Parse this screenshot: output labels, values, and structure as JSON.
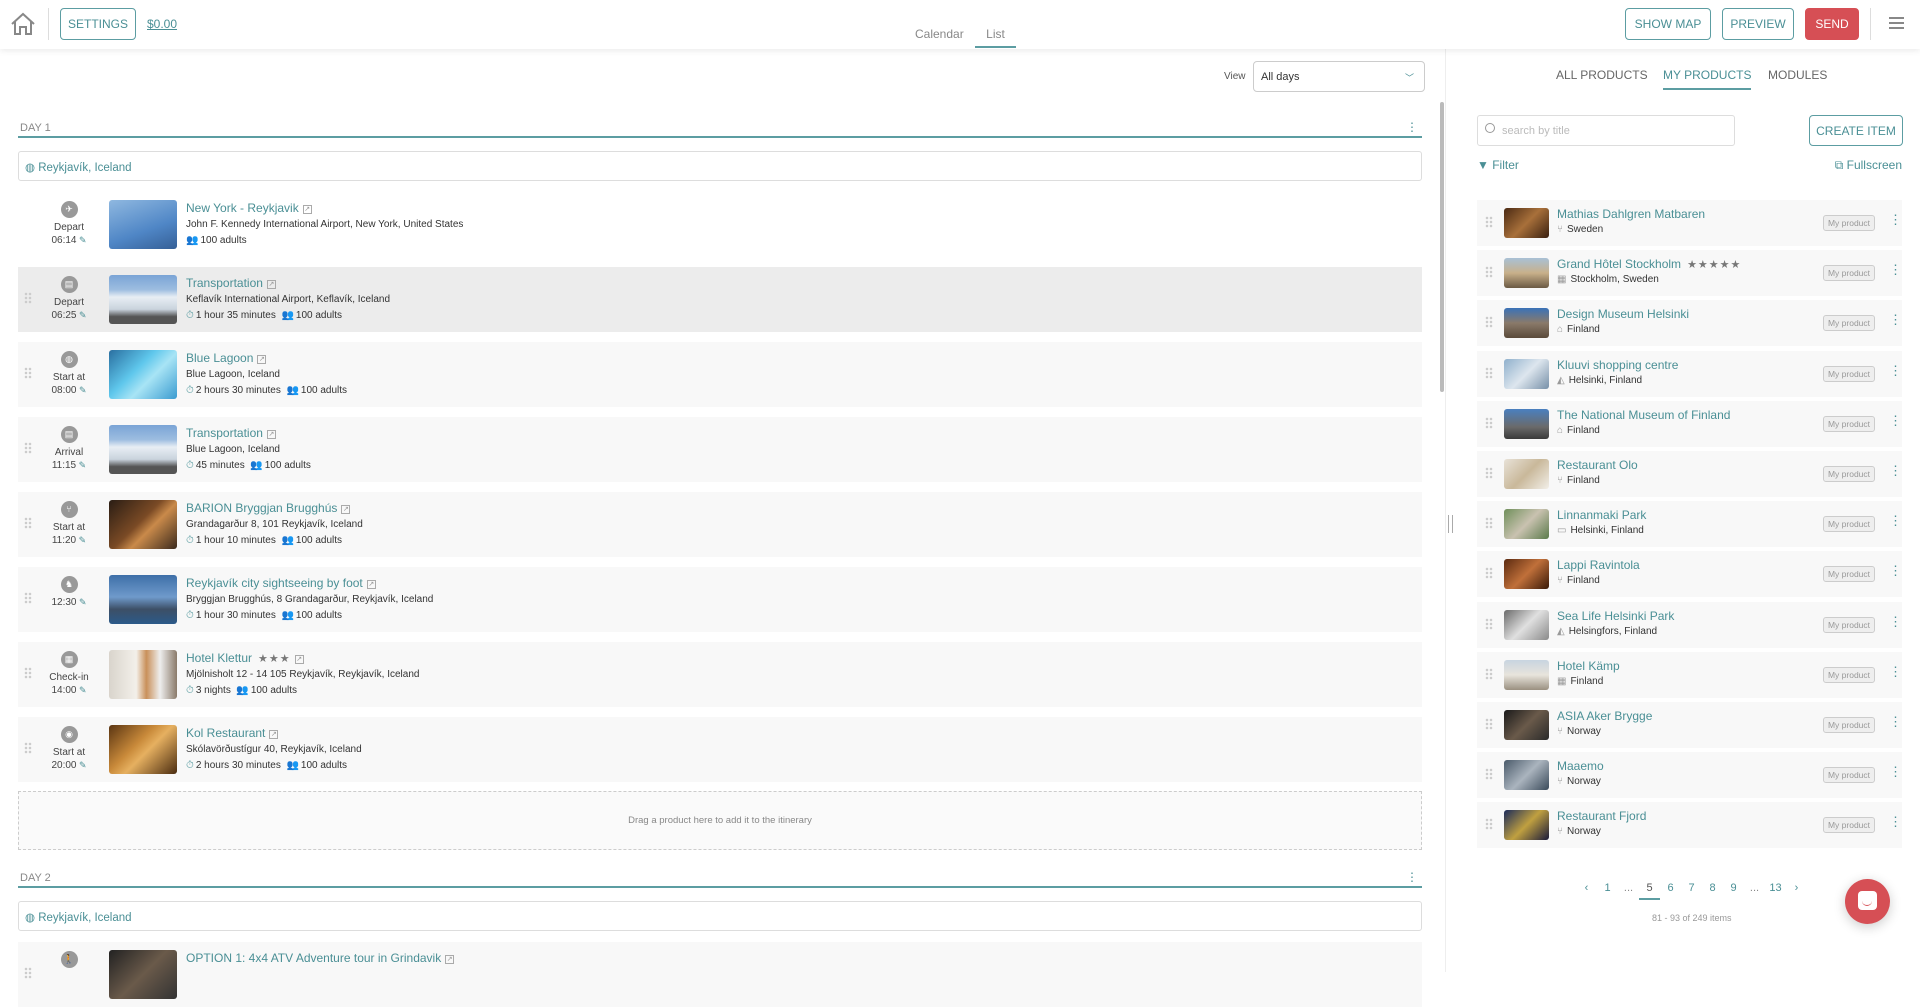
{
  "header": {
    "settings": "SETTINGS",
    "price": "$0.00",
    "view_tabs": [
      "Calendar",
      "List"
    ],
    "show_map": "SHOW MAP",
    "preview": "PREVIEW",
    "send": "SEND"
  },
  "view": {
    "label": "View",
    "selected": "All days"
  },
  "days": [
    {
      "label": "DAY 1",
      "location": "Reykjavík, Iceland",
      "rows": [
        {
          "icon": "plane-icon",
          "glyph": "✈",
          "status": "Depart",
          "time": "06:14",
          "title": "New York - Reykjavik",
          "address": "John F. Kennedy International Airport, New York, United States",
          "duration": "",
          "guests": "100 adults",
          "stars": "",
          "img": "linear-gradient(160deg,#8fb8e0,#4f86c6 60%,#355f96)"
        },
        {
          "icon": "bus-icon",
          "glyph": "▤",
          "status": "Depart",
          "time": "06:25",
          "title": "Transportation",
          "address": "Keflavík International Airport, Keflavík, Iceland",
          "duration": "1 hour 35 minutes",
          "guests": "100 adults",
          "stars": "",
          "img": "linear-gradient(180deg,#7aa4d6 0,#9dbde0 30%,#e8eef4 45%,#c9d3dd 70%,#555 85%)"
        },
        {
          "icon": "globe-icon",
          "glyph": "◍",
          "status": "Start at",
          "time": "08:00",
          "title": "Blue Lagoon",
          "address": "Blue Lagoon, Iceland",
          "duration": "2 hours 30 minutes",
          "guests": "100 adults",
          "stars": "",
          "img": "linear-gradient(135deg,#2a6fa0,#5fc7ec 40%,#a8e4f5 60%,#3a9bd0)"
        },
        {
          "icon": "bus-icon",
          "glyph": "▤",
          "status": "Arrival",
          "time": "11:15",
          "title": "Transportation",
          "address": "Blue Lagoon, Iceland",
          "duration": "45 minutes",
          "guests": "100 adults",
          "stars": "",
          "img": "linear-gradient(180deg,#7aa4d6 0,#9dbde0 30%,#e8eef4 45%,#c9d3dd 70%,#555 85%)"
        },
        {
          "icon": "restaurant-icon",
          "glyph": "⑂",
          "status": "Start at",
          "time": "11:20",
          "title": "BARION Bryggjan Brugghús",
          "address": "Grandagarður 8, 101 Reykjavík, Iceland",
          "duration": "1 hour 10 minutes",
          "guests": "100 adults",
          "stars": "",
          "img": "linear-gradient(135deg,#2a1d14,#7a4a25 45%,#c98a4a 60%,#3b2a1d)"
        },
        {
          "icon": "hiking-icon",
          "glyph": "♞",
          "status": "",
          "time": "12:30",
          "title": "Reykjavík city sightseeing by foot",
          "address": "Bryggjan Brugghús, 8 Grandagarður, Reykjavík, Iceland",
          "duration": "1 hour 30 minutes",
          "guests": "100 adults",
          "stars": "",
          "img": "linear-gradient(180deg,#3e6fa8,#6f9acb 45%,#3d4f66 70%,#2b5a8a)"
        },
        {
          "icon": "hotel-icon",
          "glyph": "▦",
          "status": "Check-in",
          "time": "14:00",
          "title": "Hotel Klettur",
          "address": "Mjölnisholt 12 - 14 105 Reykjavík, Reykjavík, Iceland",
          "duration": "3 nights",
          "guests": "100 adults",
          "stars": "★★★",
          "img": "linear-gradient(90deg,#d9d4cc,#f3f0ea 40%,#c9905a 55%,#eee 75%,#8a7a6a)"
        },
        {
          "icon": "camera-icon",
          "glyph": "◉",
          "status": "Start at",
          "time": "20:00",
          "title": "Kol Restaurant",
          "address": "Skólavörðustígur 40, Reykjavík, Iceland",
          "duration": "2 hours 30 minutes",
          "guests": "100 adults",
          "stars": "",
          "img": "linear-gradient(135deg,#5a3512,#c98a3a 40%,#e6b060 55%,#4a2c10)"
        }
      ],
      "drop_hint": "Drag a product here to add it to the itinerary"
    },
    {
      "label": "DAY 2",
      "location": "Reykjavík, Iceland",
      "rows": [
        {
          "icon": "walking-icon",
          "glyph": "🚶",
          "status": "",
          "time": "",
          "title": "OPTION 1: 4x4 ATV Adventure tour in Grindavik",
          "address": "",
          "duration": "",
          "guests": "",
          "stars": "",
          "img": "linear-gradient(135deg,#222,#6a5a4a 50%,#333)"
        }
      ]
    }
  ],
  "products": {
    "tabs": [
      "ALL PRODUCTS",
      "MY PRODUCTS",
      "MODULES"
    ],
    "active_tab": 1,
    "search_placeholder": "search by title",
    "create": "CREATE ITEM",
    "filter": "Filter",
    "fullscreen": "Fullscreen",
    "badge": "My product",
    "items": [
      {
        "title": "Mathias Dahlgren Matbaren",
        "place": "Sweden",
        "icon": "restaurant-icon",
        "glyph": "⑂",
        "stars": "",
        "img": "linear-gradient(135deg,#4a2a14,#a8703a 50%,#3a2010)"
      },
      {
        "title": "Grand Hôtel Stockholm",
        "place": "Stockholm, Sweden",
        "icon": "hotel-icon",
        "glyph": "▦",
        "stars": "★★★★★",
        "img": "linear-gradient(180deg,#a9c1d6,#c8b08a 50%,#6b5a44)"
      },
      {
        "title": "Design Museum Helsinki",
        "place": "Finland",
        "icon": "museum-icon",
        "glyph": "⌂",
        "stars": "",
        "img": "linear-gradient(180deg,#3a72b8,#8a7a6a 50%,#5a4a3a)"
      },
      {
        "title": "Kluuvi shopping centre",
        "place": "Helsinki, Finland",
        "icon": "shopping-icon",
        "glyph": "◭",
        "stars": "",
        "img": "linear-gradient(135deg,#8fb0cc,#dde6ee 50%,#7790a8)"
      },
      {
        "title": "The National Museum of Finland",
        "place": "Finland",
        "icon": "museum-icon",
        "glyph": "⌂",
        "stars": "",
        "img": "linear-gradient(180deg,#4a80c0,#6a6a6a 60%,#3a3a3a)"
      },
      {
        "title": "Restaurant Olo",
        "place": "Finland",
        "icon": "restaurant-icon",
        "glyph": "⑂",
        "stars": "",
        "img": "linear-gradient(135deg,#e8e2d8,#c9b89a 50%,#f2efe8)"
      },
      {
        "title": "Linnanmaki Park",
        "place": "Helsinki, Finland",
        "icon": "park-icon",
        "glyph": "▭",
        "stars": "",
        "img": "linear-gradient(135deg,#6f8f5a,#c9c2b0 50%,#5a7a4a)"
      },
      {
        "title": "Lappi Ravintola",
        "place": "Finland",
        "icon": "restaurant-icon",
        "glyph": "⑂",
        "stars": "",
        "img": "linear-gradient(135deg,#5a2a10,#c0703a 50%,#3a1a08)"
      },
      {
        "title": "Sea Life Helsinki Park",
        "place": "Helsingfors, Finland",
        "icon": "attraction-icon",
        "glyph": "◭",
        "stars": "",
        "img": "linear-gradient(135deg,#6a6a6a,#e0e0e0 50%,#8a8a8a)"
      },
      {
        "title": "Hotel Kämp",
        "place": "Finland",
        "icon": "hotel-icon",
        "glyph": "▦",
        "stars": "",
        "img": "linear-gradient(180deg,#c8d4e0,#e8e4dc 50%,#9a9080)"
      },
      {
        "title": "ASIA Aker Brygge",
        "place": "Norway",
        "icon": "restaurant-icon",
        "glyph": "⑂",
        "stars": "",
        "img": "linear-gradient(135deg,#1a1a1a,#6a5a4a 50%,#2a2a2a)"
      },
      {
        "title": "Maaemo",
        "place": "Norway",
        "icon": "restaurant-icon",
        "glyph": "⑂",
        "stars": "",
        "img": "linear-gradient(135deg,#4a5a6a,#aab4be 50%,#3a4a5a)"
      },
      {
        "title": "Restaurant Fjord",
        "place": "Norway",
        "icon": "restaurant-icon",
        "glyph": "⑂",
        "stars": "",
        "img": "linear-gradient(135deg,#1a2a5a,#c0a040 50%,#1a1a3a)"
      }
    ],
    "pagination": {
      "pages": [
        "1",
        "...",
        "5",
        "6",
        "7",
        "8",
        "9",
        "...",
        "13"
      ],
      "current": "5",
      "count": "81 - 93 of 249 items"
    }
  },
  "colors": {
    "accent": "#4a8f95",
    "send": "#d64f55"
  }
}
